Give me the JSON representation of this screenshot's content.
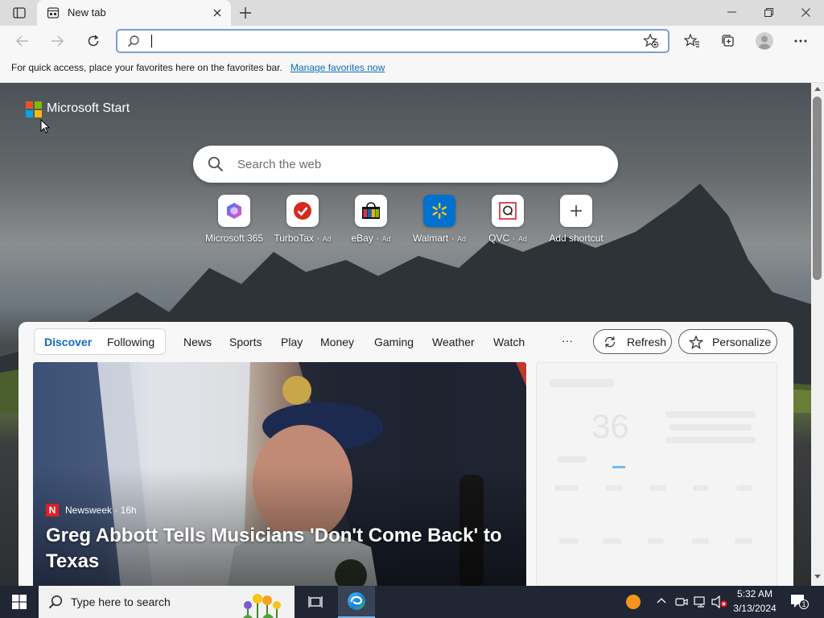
{
  "browser": {
    "tab": {
      "title": "New tab"
    },
    "address": {
      "value": "",
      "placeholder": ""
    },
    "favorites_bar": {
      "message": "For quick access, place your favorites here on the favorites bar.",
      "link": "Manage favorites now"
    }
  },
  "page": {
    "brand": "Microsoft Start",
    "search": {
      "placeholder": "Search the web"
    },
    "quick_links": [
      {
        "label": "Microsoft 365",
        "ad": "",
        "icon": "microsoft-365-icon"
      },
      {
        "label": "TurboTax",
        "ad": "Ad",
        "icon": "turbotax-icon"
      },
      {
        "label": "eBay",
        "ad": "Ad",
        "icon": "ebay-icon"
      },
      {
        "label": "Walmart",
        "ad": "Ad",
        "icon": "walmart-icon"
      },
      {
        "label": "QVC",
        "ad": "Ad",
        "icon": "qvc-icon"
      },
      {
        "label": "Add shortcut",
        "ad": "",
        "icon": "plus-icon"
      }
    ],
    "feed": {
      "tabs": [
        "Discover",
        "Following",
        "News",
        "Sports",
        "Play",
        "Money",
        "Gaming",
        "Weather",
        "Watch"
      ],
      "more": "···",
      "refresh_label": "Refresh",
      "personalize_label": "Personalize",
      "hero": {
        "source": "Newsweek · 16h",
        "headline": "Greg Abbott Tells Musicians 'Don't Come Back' to Texas"
      },
      "weather_value": "36"
    }
  },
  "taskbar": {
    "search_placeholder": "Type here to search",
    "time": "5:32 AM",
    "date": "3/13/2024",
    "notification_count": "1"
  },
  "colors": {
    "accent": "#0f6cbd",
    "taskbar": "#202633",
    "discover_tab": "#0f6cbd"
  }
}
